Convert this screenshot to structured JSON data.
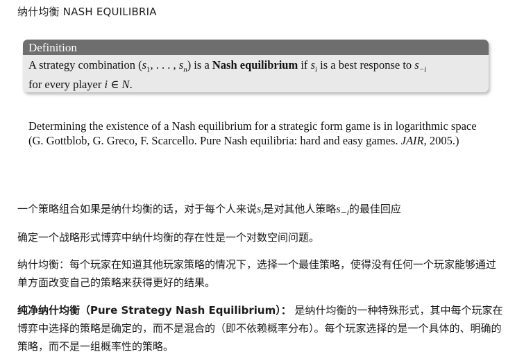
{
  "title": "纳什均衡 NASH EQUILIBRIA",
  "definition": {
    "heading": "Definition",
    "t1": "A strategy combination (",
    "s1": "s",
    "sub1": "1",
    "t2": ", . . . , ",
    "sn": "s",
    "subn": "n",
    "t3": ") is a ",
    "bold": "Nash equilibrium",
    "t4": " if ",
    "si": "s",
    "subi": "i",
    "t5": " is a best response to ",
    "smi": "s",
    "submi": "−i",
    "t6": "for every player ",
    "i": "i",
    "t7": " ∈ ",
    "N": "N",
    "t8": "."
  },
  "complexity": {
    "line1": "Determining the existence of a Nash equilibrium for a strategic form game is in logarithmic space",
    "ref_pre": "(G. Gottblob, G. Greco, F. Scarcello. Pure Nash equilibria: hard and easy games. ",
    "ref_journal": "JAIR",
    "ref_post": ", 2005.)"
  },
  "zh1": {
    "a": "一个策略组合如果是纳什均衡的话，对于每个人来说",
    "s": "s",
    "sub": "i",
    "b": "是对其他人策略",
    "s2": "s",
    "sub2": "−i",
    "c": "的最佳回应"
  },
  "zh2": "确定一个战略形式博弈中纳什均衡的存在性是一个对数空间问题。",
  "zh3": "纳什均衡：每个玩家在知道其他玩家策略的情况下，选择一个最佳策略，使得没有任何一个玩家能够通过单方面改变自己的策略来获得更好的结果。",
  "zh4": {
    "bold": "纯净纳什均衡（Pure Strategy Nash Equilibrium）：",
    "rest": " 是纳什均衡的一种特殊形式，其中每个玩家在博弈中选择的策略是确定的，而不是混合的（即不依赖概率分布）。每个玩家选择的是一个具体的、明确的策略，而不是一组概率性的策略。"
  }
}
